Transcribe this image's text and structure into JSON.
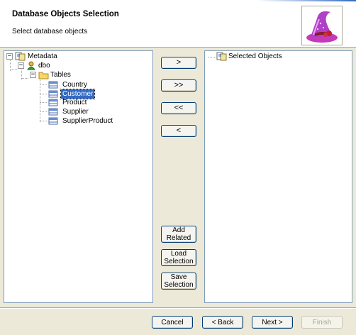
{
  "header": {
    "title": "Database Objects Selection",
    "subtitle": "Select database objects"
  },
  "source_tree": {
    "root": {
      "label": "Metadata",
      "icon": "metadata-icon"
    },
    "schema": {
      "label": "dbo",
      "icon": "schema-user-icon"
    },
    "folder": {
      "label": "Tables",
      "icon": "folder-icon"
    },
    "tables": [
      {
        "label": "Country",
        "icon": "table-icon",
        "selected": false
      },
      {
        "label": "Customer",
        "icon": "table-icon",
        "selected": true
      },
      {
        "label": "Product",
        "icon": "table-icon",
        "selected": false
      },
      {
        "label": "Supplier",
        "icon": "table-icon",
        "selected": false
      },
      {
        "label": "SupplierProduct",
        "icon": "table-icon",
        "selected": false
      }
    ]
  },
  "target_tree": {
    "root": {
      "label": "Selected Objects",
      "icon": "metadata-icon"
    }
  },
  "move_buttons": {
    "add": ">",
    "add_all": ">>",
    "remove_all": "<<",
    "remove": "<"
  },
  "side_buttons": {
    "add_related": "Add\nRelated",
    "load_selection": "Load\nSelection",
    "save_selection": "Save\nSelection"
  },
  "nav_buttons": {
    "cancel": "Cancel",
    "back": "< Back",
    "next": "Next >",
    "finish": "Finish",
    "finish_enabled": false
  },
  "colors": {
    "selection": "#316ac5",
    "dialog_bg": "#ece9d8",
    "pane_border": "#7f9db9"
  }
}
